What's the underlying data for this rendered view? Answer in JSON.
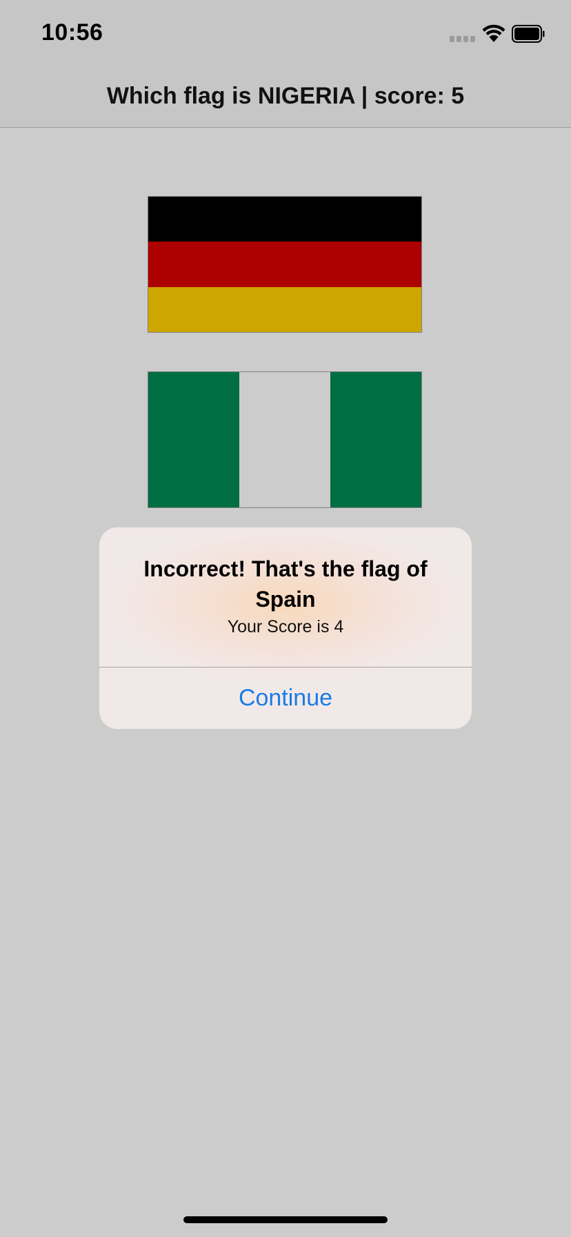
{
  "status_bar": {
    "time": "10:56",
    "icons": [
      "signal-icon",
      "wifi-icon",
      "battery-icon"
    ]
  },
  "nav": {
    "title": "Which flag is NIGERIA | score: 5"
  },
  "flags": [
    {
      "country": "Germany",
      "colors": [
        "#000000",
        "#ad0000",
        "#cea600"
      ],
      "orientation": "horizontal"
    },
    {
      "country": "Nigeria",
      "colors": [
        "#006e43",
        "#cccccc",
        "#006e43"
      ],
      "orientation": "vertical"
    }
  ],
  "alert": {
    "title": "Incorrect! That's the flag of Spain",
    "message": "Your Score is 4",
    "button_label": "Continue"
  },
  "colors": {
    "background": "#cccccc",
    "accent": "#1a7ce5"
  }
}
